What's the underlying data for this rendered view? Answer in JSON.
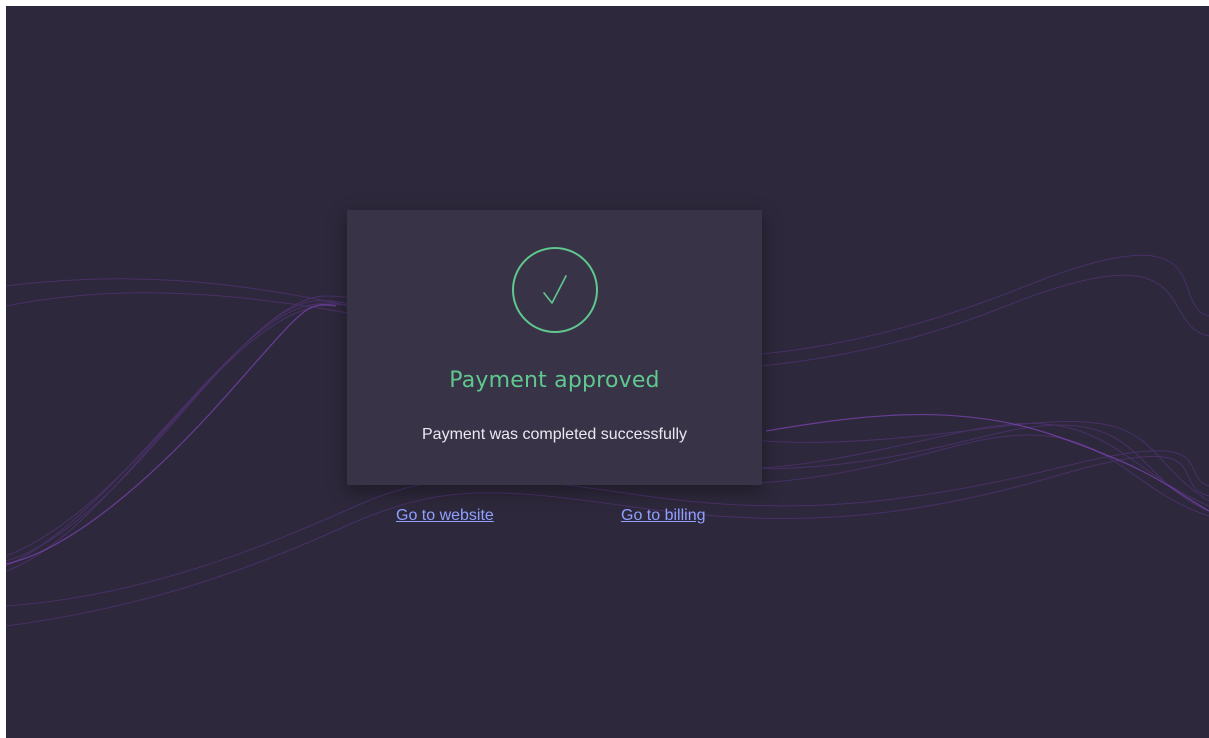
{
  "status": {
    "icon": "checkmark-circle-icon",
    "title": "Payment approved",
    "message": "Payment was completed successfully"
  },
  "links": {
    "website": "Go to website",
    "billing": "Go to billing"
  },
  "colors": {
    "background": "#2d283b",
    "card": "#393347",
    "success": "#5fc88f",
    "link": "#8fa0ff",
    "wave": "#7b3fb8"
  }
}
